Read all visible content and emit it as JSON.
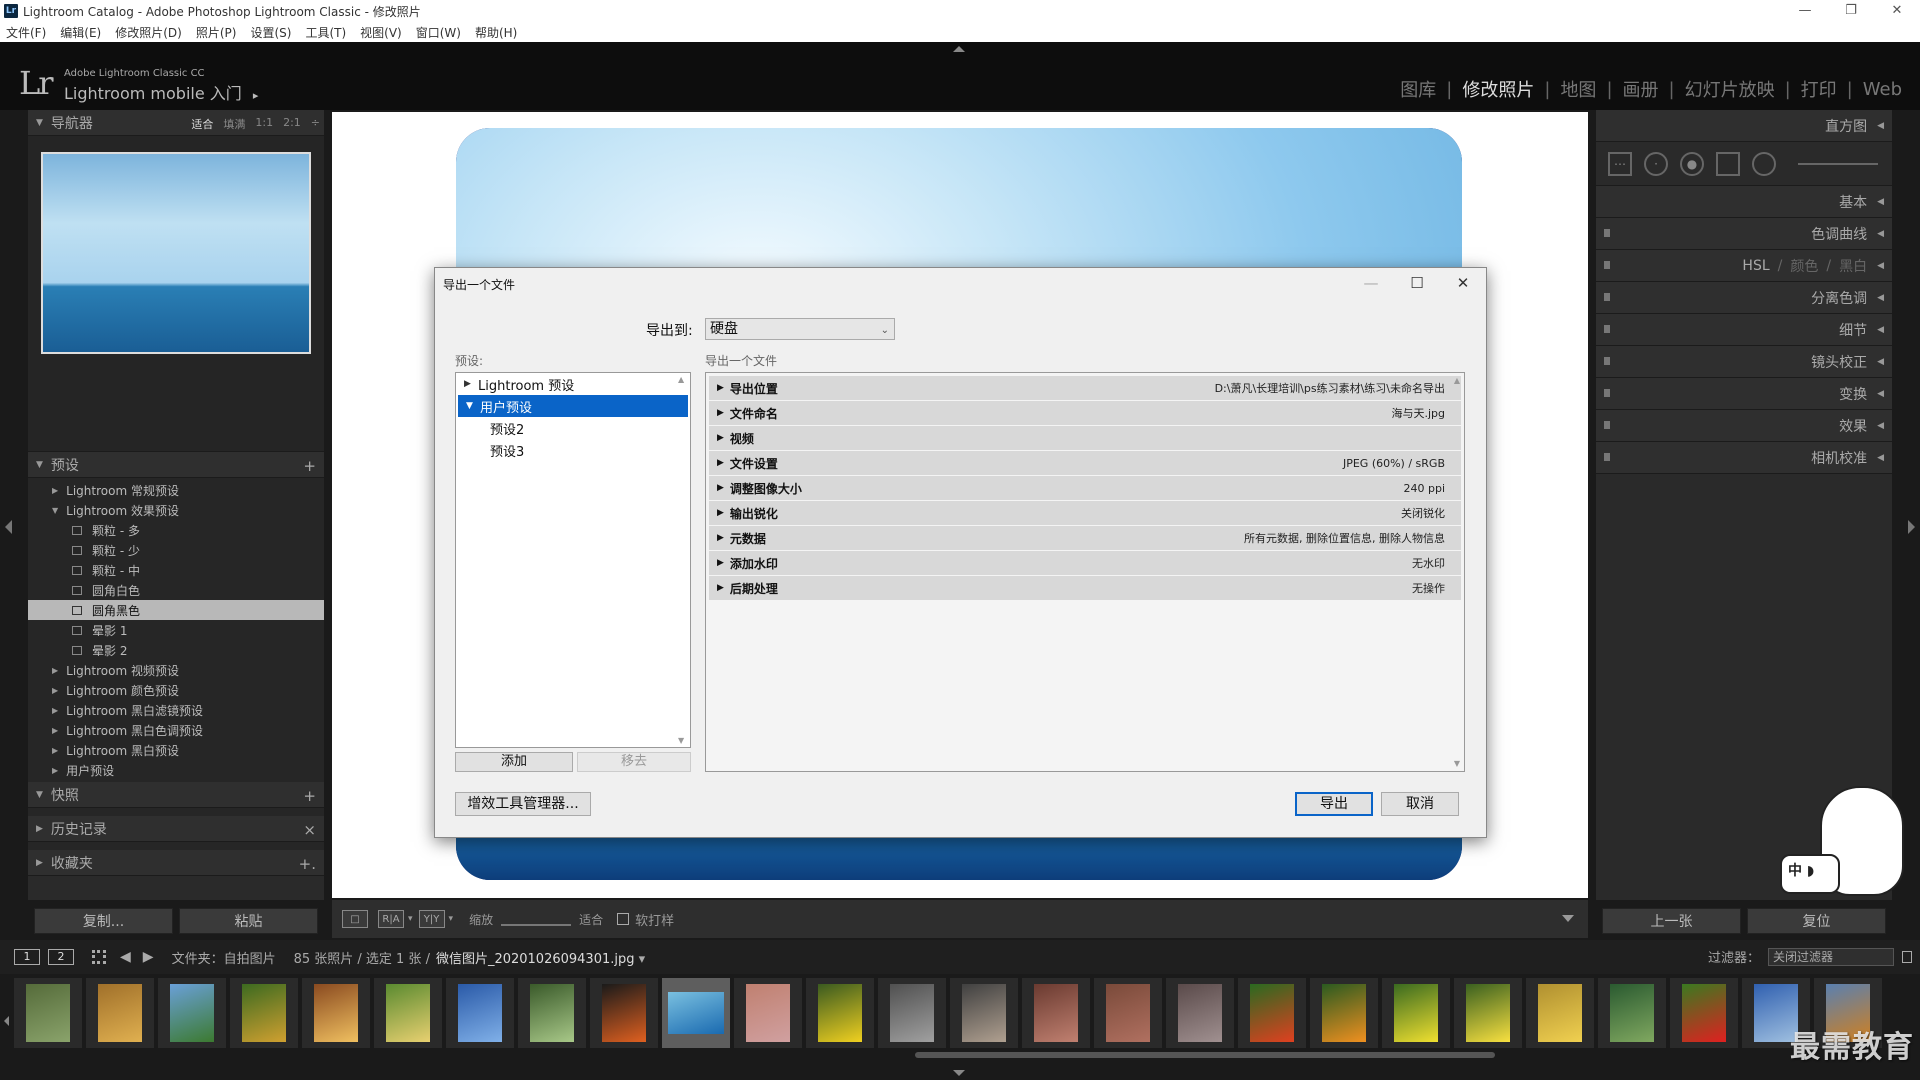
{
  "window": {
    "title": "Lightroom Catalog - Adobe Photoshop Lightroom Classic - 修改照片",
    "app_icon": "Lr",
    "controls": [
      "—",
      "❐",
      "✕"
    ]
  },
  "menu": [
    "文件(F)",
    "编辑(E)",
    "修改照片(D)",
    "照片(P)",
    "设置(S)",
    "工具(T)",
    "视图(V)",
    "窗口(W)",
    "帮助(H)"
  ],
  "identity": {
    "logo": "Lr",
    "small": "Adobe Lightroom Classic CC",
    "big": "Lightroom mobile 入门",
    "arrow": "▸"
  },
  "modules": [
    {
      "label": "图库",
      "active": false
    },
    {
      "label": "修改照片",
      "active": true
    },
    {
      "label": "地图",
      "active": false
    },
    {
      "label": "画册",
      "active": false
    },
    {
      "label": "幻灯片放映",
      "active": false
    },
    {
      "label": "打印",
      "active": false
    },
    {
      "label": "Web",
      "active": false
    }
  ],
  "navigator": {
    "title": "导航器",
    "zoom": [
      "适合",
      "填满",
      "1:1",
      "2:1",
      "÷"
    ]
  },
  "presets_panel": {
    "title": "预设",
    "items": [
      {
        "label": "Lightroom 常规预设",
        "level": 0,
        "tri": "▶",
        "selected": false
      },
      {
        "label": "Lightroom 效果预设",
        "level": 0,
        "tri": "▼",
        "selected": false
      },
      {
        "label": "颗粒 - 多",
        "level": 1,
        "selected": false
      },
      {
        "label": "颗粒 - 少",
        "level": 1,
        "selected": false
      },
      {
        "label": "颗粒 - 中",
        "level": 1,
        "selected": false
      },
      {
        "label": "圆角白色",
        "level": 1,
        "selected": false
      },
      {
        "label": "圆角黑色",
        "level": 1,
        "selected": true
      },
      {
        "label": "晕影 1",
        "level": 1,
        "selected": false
      },
      {
        "label": "晕影 2",
        "level": 1,
        "selected": false
      },
      {
        "label": "Lightroom 视频预设",
        "level": 0,
        "tri": "▶",
        "selected": false
      },
      {
        "label": "Lightroom 颜色预设",
        "level": 0,
        "tri": "▶",
        "selected": false
      },
      {
        "label": "Lightroom 黑白滤镜预设",
        "level": 0,
        "tri": "▶",
        "selected": false
      },
      {
        "label": "Lightroom 黑白色调预设",
        "level": 0,
        "tri": "▶",
        "selected": false
      },
      {
        "label": "Lightroom 黑白预设",
        "level": 0,
        "tri": "▶",
        "selected": false
      },
      {
        "label": "用户预设",
        "level": 0,
        "tri": "▶",
        "selected": false
      }
    ]
  },
  "snapshots": {
    "title": "快照",
    "action": "+"
  },
  "history": {
    "title": "历史记录",
    "action": "×"
  },
  "collections": {
    "title": "收藏夹",
    "action": "+."
  },
  "left_buttons": {
    "copy": "复制...",
    "paste": "粘贴"
  },
  "toolbar": {
    "view_loupe": "□",
    "view_ra": "R|A",
    "view_yy": "Y|Y",
    "zoom_label": "缩放",
    "zoom_value": "适合",
    "softproof": "软打样"
  },
  "right_panel": {
    "histogram": "直方图",
    "basic": "基本",
    "tone_curve": "色调曲线",
    "hsl": "HSL",
    "color": "颜色",
    "bw": "黑白",
    "split_tone": "分离色调",
    "detail": "细节",
    "lens": "镜头校正",
    "transform": "变换",
    "effects": "效果",
    "calibration": "相机校准"
  },
  "right_buttons": {
    "prev": "上一张",
    "reset": "复位"
  },
  "filmbar": {
    "view1": "1",
    "view2": "2",
    "folder": "文件夹：自拍图片",
    "count": "85 张照片 / 选定 1 张 /",
    "filename": "微信图片_20201026094301.jpg",
    "caret": "▾",
    "filter_label": "过滤器：",
    "filter_value": "关闭过滤器"
  },
  "filmstrip": {
    "thumbs": [
      {
        "c1": "#556b3a",
        "c2": "#8aa36b"
      },
      {
        "c1": "#a0702a",
        "c2": "#e0b050"
      },
      {
        "c1": "#6aa0d8",
        "c2": "#3c7a30"
      },
      {
        "c1": "#3c6a20",
        "c2": "#d0a030"
      },
      {
        "c1": "#8a4a20",
        "c2": "#f0c060"
      },
      {
        "c1": "#5a8a30",
        "c2": "#e8d070"
      },
      {
        "c1": "#2a5aa8",
        "c2": "#80b0e8"
      },
      {
        "c1": "#3a5a2a",
        "c2": "#a8c888"
      },
      {
        "c1": "#1a1a1a",
        "c2": "#e06020"
      },
      {
        "c1": "#7ac0e0",
        "c2": "#1a6ab0",
        "selected": true
      },
      {
        "c1": "#c08070",
        "c2": "#d0a0a0"
      },
      {
        "c1": "#3a5a20",
        "c2": "#f0d020"
      },
      {
        "c1": "#505050",
        "c2": "#a0a0a0"
      },
      {
        "c1": "#404040",
        "c2": "#b0a090"
      },
      {
        "c1": "#6a3a30",
        "c2": "#c08070"
      },
      {
        "c1": "#7a4a3a",
        "c2": "#b07060"
      },
      {
        "c1": "#5a4a4a",
        "c2": "#a09090"
      },
      {
        "c1": "#2a6a20",
        "c2": "#e04020"
      },
      {
        "c1": "#2a5a20",
        "c2": "#f09020"
      },
      {
        "c1": "#3a6a20",
        "c2": "#f0e030"
      },
      {
        "c1": "#3a6020",
        "c2": "#f8e040"
      },
      {
        "c1": "#b09030",
        "c2": "#f0d050"
      },
      {
        "c1": "#2a5a30",
        "c2": "#80a860"
      },
      {
        "c1": "#3a7a20",
        "c2": "#e02020"
      },
      {
        "c1": "#3060b0",
        "c2": "#a0c0e0"
      },
      {
        "c1": "#5a80b0",
        "c2": "#d08020"
      }
    ]
  },
  "dialog": {
    "title": "导出一个文件",
    "controls": [
      "—",
      "☐",
      "✕"
    ],
    "export_to_label": "导出到:",
    "export_to_value": "硬盘",
    "caret": "⌄",
    "presets_label": "预设:",
    "presets": [
      {
        "label": "Lightroom 预设",
        "tri": "▶",
        "type": "folder",
        "selected": false
      },
      {
        "label": "用户预设",
        "tri": "▼",
        "type": "folder",
        "selected": true
      },
      {
        "label": "预设2",
        "type": "leaf",
        "selected": false
      },
      {
        "label": "预设3",
        "type": "leaf",
        "selected": false
      }
    ],
    "add": "添加",
    "remove": "移去",
    "sections_label": "导出一个文件",
    "sections": [
      {
        "name": "导出位置",
        "value": "D:\\萧凡\\长理培训\\ps练习素材\\练习\\未命名导出"
      },
      {
        "name": "文件命名",
        "value": "海与天.jpg"
      },
      {
        "name": "视频",
        "value": ""
      },
      {
        "name": "文件设置",
        "value": "JPEG (60%) / sRGB"
      },
      {
        "name": "调整图像大小",
        "value": "240 ppi"
      },
      {
        "name": "输出锐化",
        "value": "关闭锐化"
      },
      {
        "name": "元数据",
        "value": "所有元数据, 删除位置信息, 删除人物信息"
      },
      {
        "name": "添加水印",
        "value": "无水印"
      },
      {
        "name": "后期处理",
        "value": "无操作"
      }
    ],
    "plugin_manager": "增效工具管理器...",
    "export": "导出",
    "cancel": "取消"
  },
  "ime": {
    "label": "中 ◗"
  },
  "watermark": "最需教育"
}
